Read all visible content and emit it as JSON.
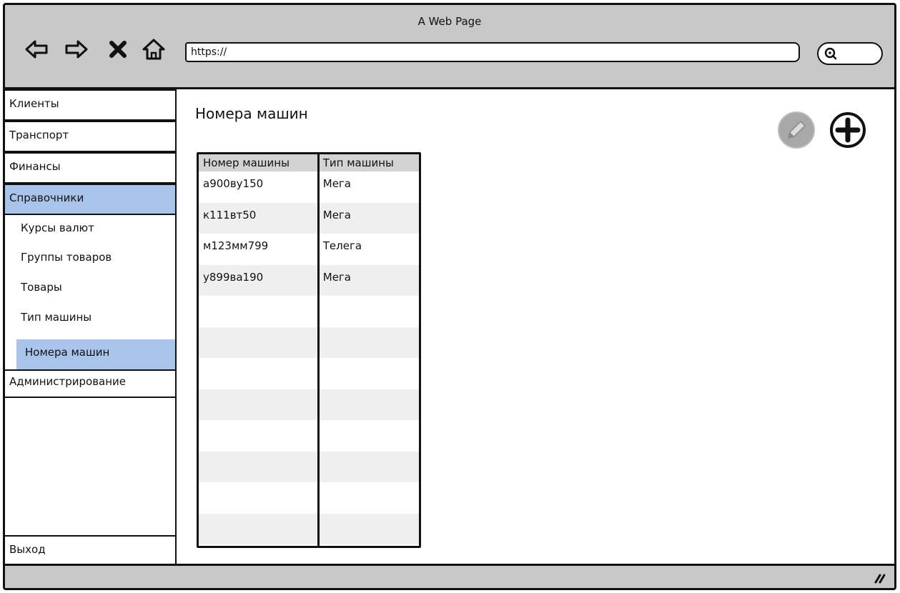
{
  "window": {
    "title": "A Web Page"
  },
  "toolbar": {
    "url": "https://",
    "icons": [
      "back-arrow-icon",
      "forward-arrow-icon",
      "close-x-icon",
      "home-icon",
      "search-icon"
    ]
  },
  "sidebar": {
    "items": [
      {
        "label": "Клиенты"
      },
      {
        "label": "Транспорт"
      },
      {
        "label": "Финансы"
      },
      {
        "label": "Справочники"
      },
      {
        "label": "Администрирование"
      },
      {
        "label": "Выход"
      }
    ],
    "sub_items": [
      {
        "label": "Курсы валют"
      },
      {
        "label": "Группы товаров"
      },
      {
        "label": "Товары"
      },
      {
        "label": "Тип машины"
      },
      {
        "label": "Номера машин"
      }
    ]
  },
  "main": {
    "title": "Номера машин",
    "actions": {
      "edit_icon": "pencil-icon",
      "add_icon": "plus-circle-icon"
    },
    "table": {
      "headers": [
        "Номер машины",
        "Тип машины"
      ],
      "rows": [
        [
          "а900ву150",
          "Мега"
        ],
        [
          "к111вт50",
          "Мега"
        ],
        [
          "м123мм799",
          "Телега"
        ],
        [
          "у899ва190",
          "Мега"
        ]
      ]
    }
  },
  "colors": {
    "chrome": "#c8c8c8",
    "selected": "#a9c4eb",
    "border": "#111111"
  }
}
